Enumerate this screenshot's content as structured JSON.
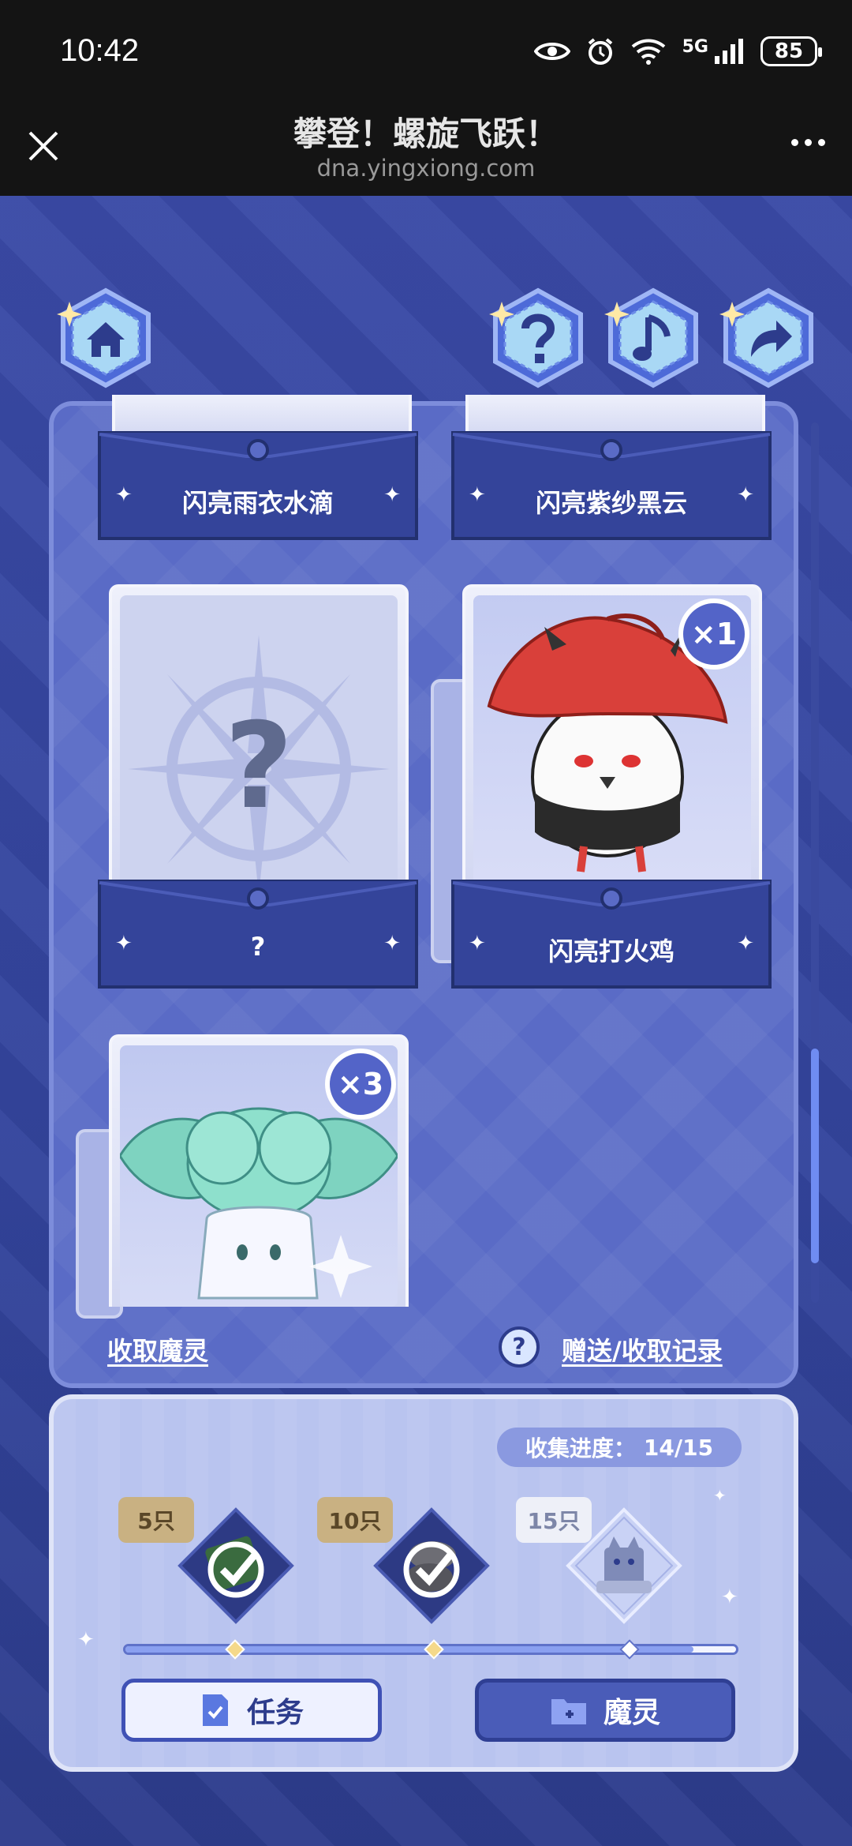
{
  "status_bar": {
    "time": "10:42",
    "network": "5G",
    "battery": "85",
    "icons": [
      "eye-icon",
      "alarm-icon",
      "wifi-icon",
      "signal-icon",
      "battery-icon"
    ]
  },
  "header": {
    "title": "攀登！螺旋飞跃！",
    "url": "dna.yingxiong.com"
  },
  "toolbar": {
    "home_icon": "home-icon",
    "help_icon": "help-icon",
    "music_icon": "music-icon",
    "share_icon": "share-icon"
  },
  "cards": [
    {
      "label": "闪亮雨衣水滴"
    },
    {
      "label": "闪亮紫纱黑云"
    },
    {
      "label": "?",
      "art_mark": "?"
    },
    {
      "label": "闪亮打火鸡",
      "count": "×1"
    },
    {
      "label": "",
      "count": "×3"
    }
  ],
  "links": {
    "collect": "收取魔灵",
    "help_mark": "?",
    "history": "赠送/收取记录"
  },
  "collection": {
    "progress_label": "收集进度：",
    "progress_value": "14/15",
    "progress": 0.93,
    "milestones": [
      {
        "tag": "5只",
        "claimed": true
      },
      {
        "tag": "10只",
        "claimed": true
      },
      {
        "tag": "15只",
        "claimed": false
      }
    ]
  },
  "buttons": {
    "tasks": "任务",
    "spirits": "魔灵"
  },
  "colors": {
    "background": "#2d3c8c",
    "panel": "#5a6bc6",
    "accent": "#3f51b5",
    "pocket": "#34449a"
  }
}
